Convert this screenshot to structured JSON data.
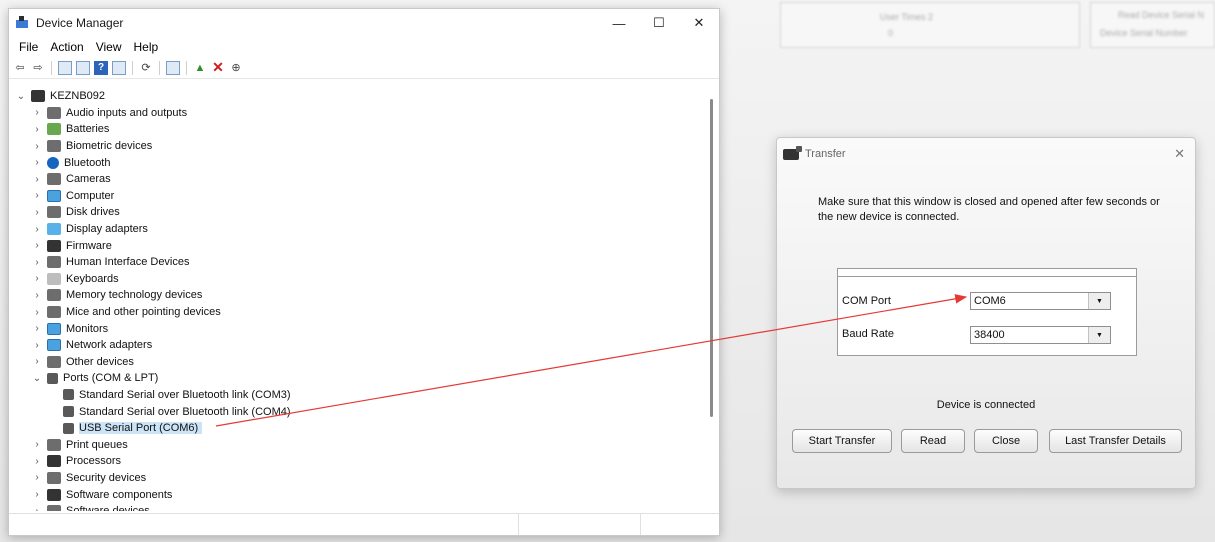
{
  "device_manager": {
    "title": "Device Manager",
    "window_buttons": [
      "—",
      "☐",
      "✕"
    ],
    "menu": [
      "File",
      "Action",
      "View",
      "Help"
    ],
    "root": "KEZNB092",
    "categories": [
      {
        "label": "Audio inputs and outputs",
        "icon": "speaker-icon"
      },
      {
        "label": "Batteries",
        "icon": "battery-icon"
      },
      {
        "label": "Biometric devices",
        "icon": "fingerprint-icon"
      },
      {
        "label": "Bluetooth",
        "icon": "bluetooth-icon"
      },
      {
        "label": "Cameras",
        "icon": "camera-icon"
      },
      {
        "label": "Computer",
        "icon": "computer-icon"
      },
      {
        "label": "Disk drives",
        "icon": "disk-icon"
      },
      {
        "label": "Display adapters",
        "icon": "display-adapter-icon"
      },
      {
        "label": "Firmware",
        "icon": "firmware-icon"
      },
      {
        "label": "Human Interface Devices",
        "icon": "hid-icon"
      },
      {
        "label": "Keyboards",
        "icon": "keyboard-icon"
      },
      {
        "label": "Memory technology devices",
        "icon": "memory-icon"
      },
      {
        "label": "Mice and other pointing devices",
        "icon": "mouse-icon"
      },
      {
        "label": "Monitors",
        "icon": "monitor-icon"
      },
      {
        "label": "Network adapters",
        "icon": "network-icon"
      },
      {
        "label": "Other devices",
        "icon": "unknown-device-icon"
      }
    ],
    "ports": {
      "label": "Ports (COM & LPT)",
      "children": [
        "Standard Serial over Bluetooth link (COM3)",
        "Standard Serial over Bluetooth link (COM4)",
        "USB Serial Port (COM6)"
      ]
    },
    "after_ports": [
      {
        "label": "Print queues",
        "icon": "printer-icon"
      },
      {
        "label": "Processors",
        "icon": "processor-icon"
      },
      {
        "label": "Security devices",
        "icon": "security-icon"
      },
      {
        "label": "Software components",
        "icon": "software-component-icon"
      },
      {
        "label": "Software devices",
        "icon": "software-device-icon"
      }
    ]
  },
  "transfer": {
    "title": "Transfer",
    "message": "Make sure that this window is closed and opened after few seconds or the new device is connected.",
    "com_port_label": "COM Port",
    "com_port_value": "COM6",
    "baud_rate_label": "Baud Rate",
    "baud_rate_value": "38400",
    "status": "Device is connected",
    "buttons": {
      "start": "Start Transfer",
      "read": "Read",
      "close": "Close",
      "details": "Last Transfer Details"
    }
  },
  "background": {
    "text1": "User Times 2",
    "text2": "0",
    "text3": "Read Device Serial N",
    "text4": "Device Serial Number"
  },
  "colors": {
    "selection": "#cce4f7",
    "annotation_arrow": "#e53935"
  }
}
